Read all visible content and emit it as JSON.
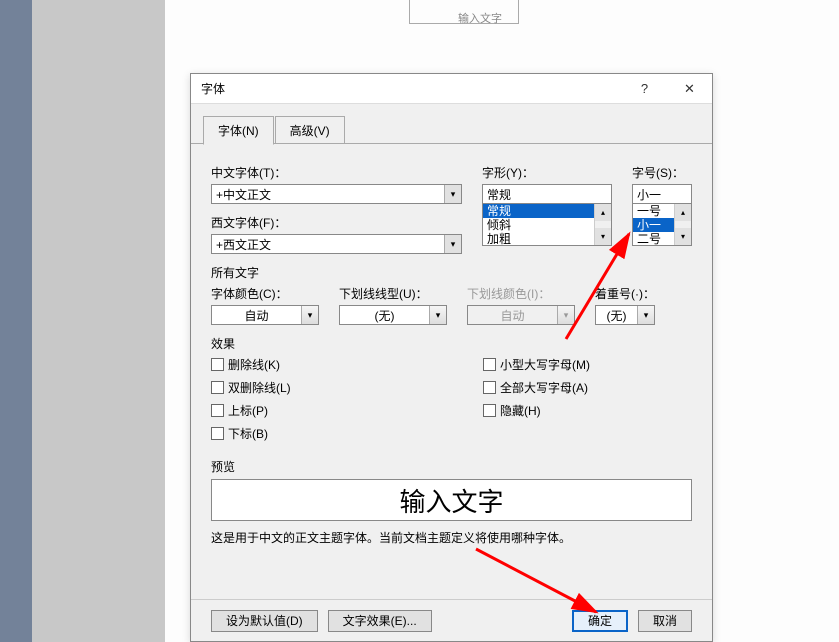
{
  "doc_placeholder": "输入文字",
  "dialog": {
    "title": "字体",
    "tabs": {
      "font": "字体(N)",
      "advanced": "高级(V)"
    },
    "labels": {
      "chinese_font": "中文字体(T)：",
      "western_font": "西文字体(F)：",
      "font_style": "字形(Y)：",
      "font_size": "字号(S)：",
      "all_text": "所有文字",
      "font_color": "字体颜色(C)：",
      "underline_style": "下划线线型(U)：",
      "underline_color": "下划线颜色(I)：",
      "emphasis": "着重号(·)：",
      "effects": "效果",
      "preview": "预览"
    },
    "chinese_font_value": "+中文正文",
    "western_font_value": "+西文正文",
    "font_style_value": "常规",
    "font_style_options": [
      "常规",
      "倾斜",
      "加粗"
    ],
    "font_size_value": "小一",
    "font_size_options": [
      "一号",
      "小一",
      "二号"
    ],
    "font_color_value": "自动",
    "underline_style_value": "(无)",
    "underline_color_value": "自动",
    "emphasis_value": "(无)",
    "checkboxes": {
      "strike": "删除线(K)",
      "double_strike": "双删除线(L)",
      "superscript": "上标(P)",
      "subscript": "下标(B)",
      "small_caps": "小型大写字母(M)",
      "all_caps": "全部大写字母(A)",
      "hidden": "隐藏(H)"
    },
    "preview_text": "输入文字",
    "preview_note": "这是用于中文的正文主题字体。当前文档主题定义将使用哪种字体。",
    "buttons": {
      "set_default": "设为默认值(D)",
      "text_effects": "文字效果(E)...",
      "ok": "确定",
      "cancel": "取消"
    }
  }
}
